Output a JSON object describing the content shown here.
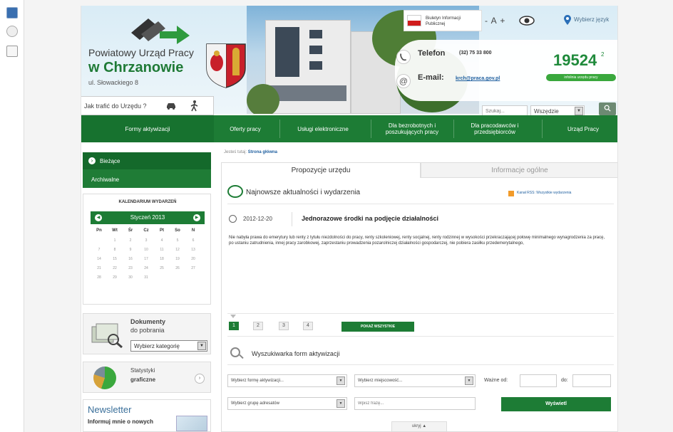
{
  "header": {
    "org_title": "Powiatowy Urząd Pracy",
    "org_city": "w Chrzanowie",
    "address": "ul. Słowackiego 8",
    "bip_label": "Biuletyn Informacji Publicznej",
    "font_size_control": "- A +",
    "language_label": "Wybierz język",
    "phone_label": "Telefon",
    "phone_number": "(32) 75 33 800",
    "email_label": "E-mail:",
    "email_value": "krch@praca.gov.pl",
    "counter_value": "19524",
    "counter_sup": "2",
    "counter_label": "infolinia urzędu pracy",
    "directions_label": "Jak trafić do Urzędu ?",
    "search_placeholder": "Szukaj...",
    "search_scope": "Wszędzie",
    "search_button_icon": "search-icon"
  },
  "nav": {
    "items": [
      {
        "label": "Formy aktywizacji"
      },
      {
        "label": "Oferty pracy"
      },
      {
        "label": "Usługi elektroniczne"
      },
      {
        "label": "Dla bezrobotnych i poszukujących pracy"
      },
      {
        "label": "Dla pracodawców i przedsiębiorców"
      },
      {
        "label": "Urząd Pracy"
      }
    ]
  },
  "sidebar": {
    "current": "Bieżące",
    "archive": "Archiwalne",
    "calendar_title": "KALENDARIUM WYDARZEŃ",
    "calendar_month": "Styczeń 2013",
    "weekdays": [
      "Pn",
      "Wt",
      "Śr",
      "Cz",
      "Pt",
      "So",
      "N"
    ],
    "days": [
      "",
      "1",
      "2",
      "3",
      "4",
      "5",
      "6",
      "7",
      "8",
      "9",
      "10",
      "11",
      "12",
      "13",
      "14",
      "15",
      "16",
      "17",
      "18",
      "19",
      "20",
      "21",
      "22",
      "23",
      "24",
      "25",
      "26",
      "27",
      "28",
      "29",
      "30",
      "31"
    ],
    "docs_title": "Dokumenty",
    "docs_sub": "do pobrania",
    "docs_select": "Wybierz kategorię",
    "stats_title": "Statystyki",
    "stats_sub": "graficzne",
    "news_title": "Newsletter",
    "news_text": "Informuj mnie o nowych"
  },
  "main": {
    "breadcrumb_prefix": "Jesteś tutaj:",
    "breadcrumb_current": "Strona główna",
    "tab_proposals": "Propozycje urzędu",
    "tab_general": "Informacje ogólne",
    "news_title": "Najnowsze aktualności i wydarzenia",
    "rss_label": "Kanał RSS: Wszystkie wydarzenia",
    "article_date": "2012-12-20",
    "article_title": "Jednorazowe środki na podjęcie działalności",
    "article_body": "Nie nabyła prawa do emerytury lub renty z tytułu niezdolności do pracy, renty szkoleniowej, renty socjalnej, renty rodzinnej w wysokości przekraczającej połowę minimalnego wynagrodzenia za pracę, po ustaniu zatrudnienia, innej pracy zarobkowej, zaprzestaniu prowadzenia pozarolniczej działalności gospodarczej, nie pobiera zasiłku przedemerytalnego,",
    "pages": [
      "1",
      "2",
      "3",
      "4"
    ],
    "show_all": "POKAŻ WSZYSTKIE",
    "finder_title": "Wyszukiwarka form aktywizacji",
    "form_select": "Wybierz formę aktywizacji...",
    "place_select": "Wybierz miejscowość...",
    "valid_from_label": "Ważne od:",
    "valid_to_label": "do:",
    "group_select": "Wybierz grupę adresatów",
    "phrase_placeholder": "Wpisz frazę...",
    "show_button": "Wyświetl",
    "hide_label": "ukryj ▲"
  },
  "colors": {
    "brand_green": "#1d7c35",
    "accent_green": "#3aa83d",
    "link_blue": "#1f5f9f"
  }
}
